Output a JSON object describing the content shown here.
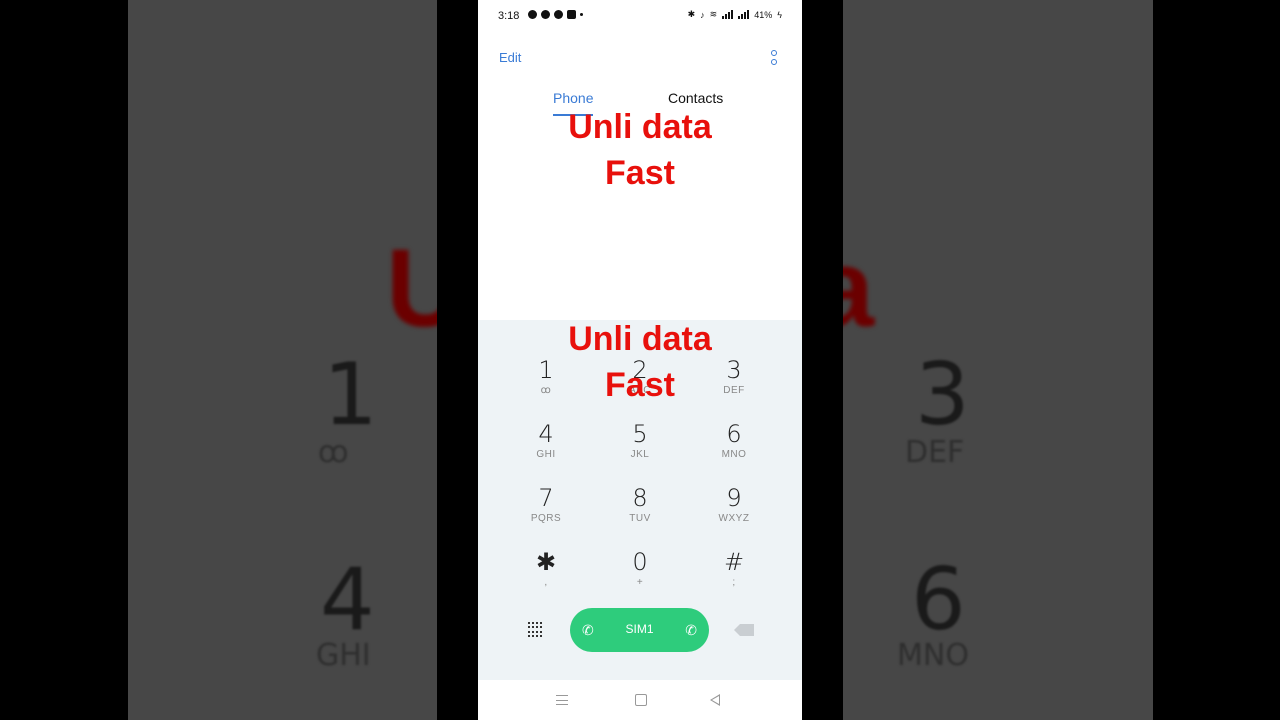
{
  "status_bar": {
    "time": "3:18",
    "battery": "41%",
    "icons": [
      "messenger-icon",
      "facebook-icon",
      "sync-icon",
      "app-icon",
      "dot-icon",
      "bluetooth-icon",
      "mute-icon",
      "wifi-icon",
      "signal-icon",
      "signal-icon",
      "charging-icon"
    ]
  },
  "header": {
    "edit_label": "Edit",
    "menu_icon": "more-vertical-icon"
  },
  "tabs": [
    {
      "label": "Phone",
      "active": true
    },
    {
      "label": "Contacts",
      "active": false
    }
  ],
  "overlay": {
    "line1": "Unli data",
    "line2": "Fast"
  },
  "keypad": [
    {
      "num": "1",
      "letters": "ꝏ"
    },
    {
      "num": "2",
      "letters": "ABC"
    },
    {
      "num": "3",
      "letters": "DEF"
    },
    {
      "num": "4",
      "letters": "GHI"
    },
    {
      "num": "5",
      "letters": "JKL"
    },
    {
      "num": "6",
      "letters": "MNO"
    },
    {
      "num": "7",
      "letters": "PQRS"
    },
    {
      "num": "8",
      "letters": "TUV"
    },
    {
      "num": "9",
      "letters": "WXYZ"
    },
    {
      "num": "✱",
      "letters": ","
    },
    {
      "num": "0",
      "letters": "+"
    },
    {
      "num": "#",
      "letters": ";"
    }
  ],
  "call": {
    "label": "SIM1",
    "sim1_icon": "phone-sim1-icon",
    "sim2_icon": "phone-sim2-icon"
  },
  "colors": {
    "accent": "#3a7bd5",
    "call_green": "#2ecc7c",
    "overlay_red": "#e8100c"
  }
}
